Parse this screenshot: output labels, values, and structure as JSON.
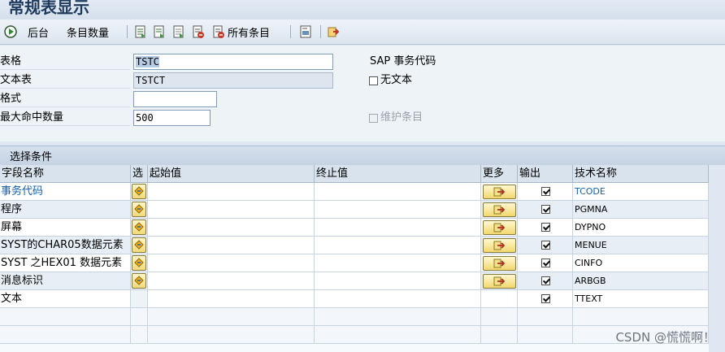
{
  "window": {
    "title": "常规表显示"
  },
  "toolbar": {
    "execute_icon": "clock-execute-icon",
    "background_label": "后台",
    "entry_count_label": "条目数量",
    "all_entries_label": "所有条目"
  },
  "form": {
    "table_label": "表格",
    "table_value": "TSTC",
    "table_desc": "SAP 事务代码",
    "text_table_label": "文本表",
    "text_table_value": "TSTCT",
    "no_text_label": "无文本",
    "layout_label": "格式",
    "layout_value": "",
    "max_hits_label": "最大命中数量",
    "max_hits_value": "500",
    "maintain_entries_label": "维护条目"
  },
  "selection": {
    "title": "选择条件",
    "headers": {
      "field_name": "字段名称",
      "sel": "选",
      "from": "起始值",
      "to": "终止值",
      "more": "更多",
      "output": "输出",
      "tech_name": "技术名称"
    },
    "rows": [
      {
        "field": "事务代码",
        "tech": "TCODE",
        "key": true
      },
      {
        "field": "程序",
        "tech": "PGMNA",
        "key": false
      },
      {
        "field": "屏幕",
        "tech": "DYPNO",
        "key": false
      },
      {
        "field": "SYST的CHAR05数据元素",
        "tech": "MENUE",
        "key": false
      },
      {
        "field": "SYST 之HEX01 数据元素",
        "tech": "CINFO",
        "key": false
      },
      {
        "field": "消息标识",
        "tech": "ARBGB",
        "key": false
      },
      {
        "field": "文本",
        "tech": "TTEXT",
        "key": false
      }
    ]
  },
  "watermark": "CSDN @慌慌啊！"
}
